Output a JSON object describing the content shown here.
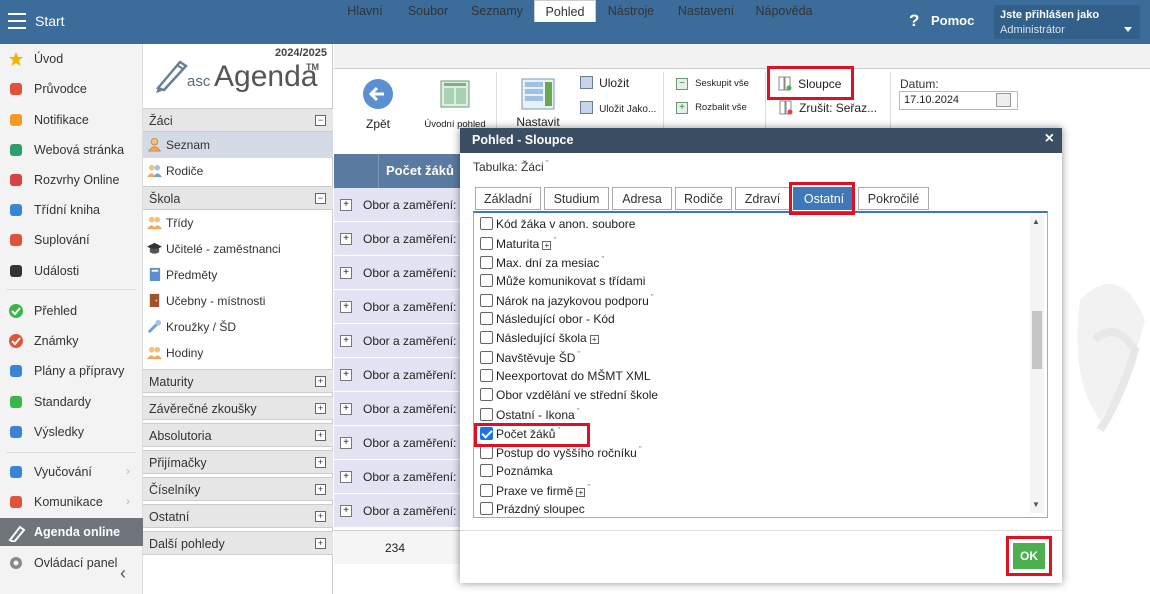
{
  "topbar": {
    "start": "Start",
    "help_icon": "?",
    "help": "Pomoc",
    "user_line1": "Jste přihlášen jako",
    "user_line2": "Administrátor"
  },
  "leftnav": [
    {
      "label": "Úvod",
      "icon": "star-icon",
      "color": "#f0b400"
    },
    {
      "label": "Průvodce",
      "icon": "wand-icon",
      "color": "#e0523a"
    },
    {
      "label": "Notifikace",
      "icon": "envelope-icon",
      "color": "#f39b24"
    },
    {
      "label": "Webová stránka",
      "icon": "house-icon",
      "color": "#2e9e6a"
    },
    {
      "label": "Rozvrhy Online",
      "icon": "grid-icon",
      "color": "#d64545"
    },
    {
      "label": "Třídní kniha",
      "icon": "book-icon",
      "color": "#3a86d4"
    },
    {
      "label": "Suplování",
      "icon": "person-icon",
      "color": "#e0523a"
    },
    {
      "label": "Události",
      "icon": "calendar-icon",
      "color": "#333333"
    },
    {
      "label": "Přehled",
      "icon": "check-circle-icon",
      "color": "#3bb54a"
    },
    {
      "label": "Známky",
      "icon": "trend-icon",
      "color": "#e0523a"
    },
    {
      "label": "Plány a přípravy",
      "icon": "briefcase-icon",
      "color": "#3a86d4"
    },
    {
      "label": "Standardy",
      "icon": "shield-icon",
      "color": "#3bb54a"
    },
    {
      "label": "Výsledky",
      "icon": "bar-icon",
      "color": "#3a86d4"
    },
    {
      "label": "Vyučování",
      "icon": "book-open-icon",
      "color": "#3a86d4"
    },
    {
      "label": "Komunikace",
      "icon": "chat-icon",
      "color": "#e0523a"
    },
    {
      "label": "Agenda online",
      "icon": "pen-icon",
      "color": "#ffffff"
    },
    {
      "label": "Ovládací panel",
      "icon": "gear-icon",
      "color": "#888888"
    }
  ],
  "logo": {
    "year": "2024/2025",
    "asc": "asc",
    "agenda": "Agenda",
    "tm": "TM"
  },
  "sections": {
    "zaci": "Žáci",
    "zaci_items": [
      "Seznam",
      "Rodiče"
    ],
    "skola": "Škola",
    "skola_items": [
      "Třídy",
      "Učitelé - zaměstnanci",
      "Předměty",
      "Učebny - místnosti",
      "Kroužky / ŠD",
      "Hodiny"
    ],
    "others": [
      "Maturity",
      "Závěrečné zkoušky",
      "Absolutoria",
      "Přijímačky",
      "Číselníky",
      "Ostatní",
      "Další pohledy"
    ],
    "minus": "−",
    "plus": "+"
  },
  "tabs": [
    "Hlavní",
    "Soubor",
    "Seznamy",
    "Pohled",
    "Nástroje",
    "Nastavení",
    "Nápověda"
  ],
  "ribbon": {
    "zpet": "Zpět",
    "uvodni": "Úvodní pohled",
    "nastavit": "Nastavit",
    "ulozit": "Uložit",
    "ulozit_jako": "Uložit Jako...",
    "seskupit": "Seskupit vše",
    "rozbalit": "Rozbalit vše",
    "sloupce": "Sloupce",
    "zrusit": "Zrušit: Seřaz...",
    "datum_label": "Datum:",
    "datum_value": "17.10.2024"
  },
  "grid": {
    "header": "Počet žáků",
    "row_label": "Obor a zaměření:",
    "plus": "+",
    "footer_value": "234"
  },
  "dialog": {
    "title": "Pohled - Sloupce",
    "close": "×",
    "subtitle": "Tabulka: Žáci",
    "tabs": [
      "Základní",
      "Studium",
      "Adresa",
      "Rodiče",
      "Zdraví",
      "Ostatní",
      "Pokročilé"
    ],
    "items": [
      {
        "label": "Kód žáka v anon. soubore",
        "checked": false,
        "plus": false
      },
      {
        "label": "Maturita",
        "checked": false,
        "plus": true
      },
      {
        "label": "Max. dní za mesiac",
        "checked": false,
        "plus": false
      },
      {
        "label": "Může komunikovat s třídami",
        "checked": false,
        "plus": false
      },
      {
        "label": "Nárok na jazykovou podporu",
        "checked": false,
        "plus": false
      },
      {
        "label": "Následující obor - Kód",
        "checked": false,
        "plus": false
      },
      {
        "label": "Následující škola",
        "checked": false,
        "plus": true
      },
      {
        "label": "Navštěvuje ŠD",
        "checked": false,
        "plus": false
      },
      {
        "label": "Neexportovat do MŠMT XML",
        "checked": false,
        "plus": false
      },
      {
        "label": "Obor vzdělání ve střední škole",
        "checked": false,
        "plus": false
      },
      {
        "label": "Ostatní - Ikona",
        "checked": false,
        "plus": false
      },
      {
        "label": "Počet žáků",
        "checked": true,
        "plus": false
      },
      {
        "label": "Postup do vyššího ročníku",
        "checked": false,
        "plus": false
      },
      {
        "label": "Poznámka",
        "checked": false,
        "plus": false
      },
      {
        "label": "Praxe ve firmě",
        "checked": false,
        "plus": true
      },
      {
        "label": "Prázdný sloupec",
        "checked": false,
        "plus": false
      }
    ],
    "ok": "OK"
  }
}
